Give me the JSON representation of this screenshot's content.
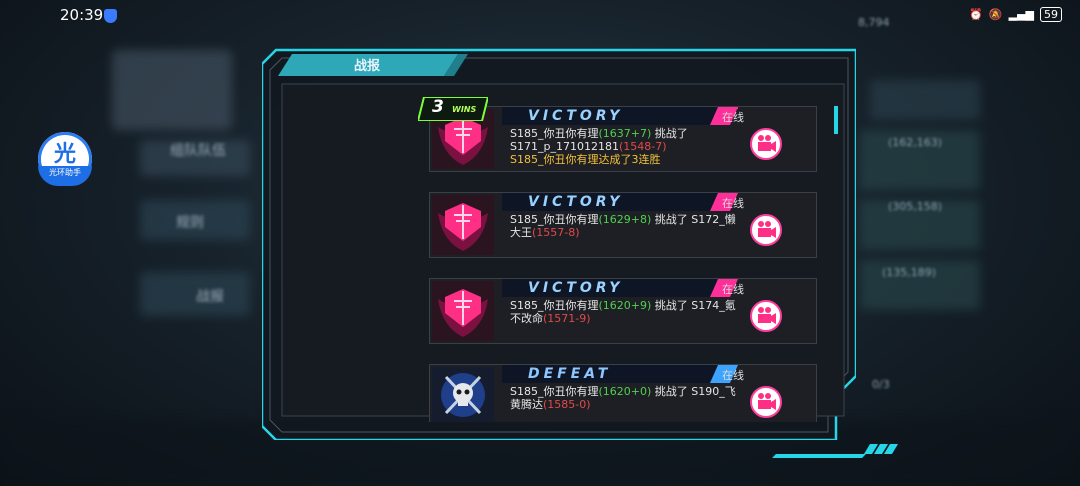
{
  "status_bar": {
    "time": "20:39",
    "battery": "59"
  },
  "assistant": {
    "char": "光",
    "label": "光环助手"
  },
  "background": {
    "left_menu": [
      "组队队伍",
      "规则",
      "战报"
    ],
    "right_values": [
      "8,794",
      "(162,163)",
      "(305,158)",
      "(135,189)",
      "0/3"
    ]
  },
  "panel": {
    "title": "战报"
  },
  "streak_badge": {
    "count": "3",
    "label": "WINS"
  },
  "reports": [
    {
      "result": "VICTORY",
      "status": "在线",
      "player": "S185_你丑你有理",
      "player_score": "(1637+7)",
      "verb": "挑战了",
      "opponent": "S171_p_171012181",
      "opponent_score": "(1548-7)",
      "streak_text": "S185_你丑你有理达成了3连胜"
    },
    {
      "result": "VICTORY",
      "status": "在线",
      "player": "S185_你丑你有理",
      "player_score": "(1629+8)",
      "verb": "挑战了",
      "opponent": "S172_懒大王",
      "opponent_score": "(1557-8)",
      "streak_text": ""
    },
    {
      "result": "VICTORY",
      "status": "在线",
      "player": "S185_你丑你有理",
      "player_score": "(1620+9)",
      "verb": "挑战了",
      "opponent": "S174_氪不改命",
      "opponent_score": "(1571-9)",
      "streak_text": ""
    },
    {
      "result": "DEFEAT",
      "status": "在线",
      "player": "S185_你丑你有理",
      "player_score": "(1620+0)",
      "verb": "挑战了",
      "opponent": "S190_飞黄腾达",
      "opponent_score": "(1585-0)",
      "streak_text": ""
    }
  ],
  "colors": {
    "victory_accent": "#ff2f9a",
    "defeat_accent": "#3ea3ff",
    "panel_border": "#27d5e8"
  }
}
